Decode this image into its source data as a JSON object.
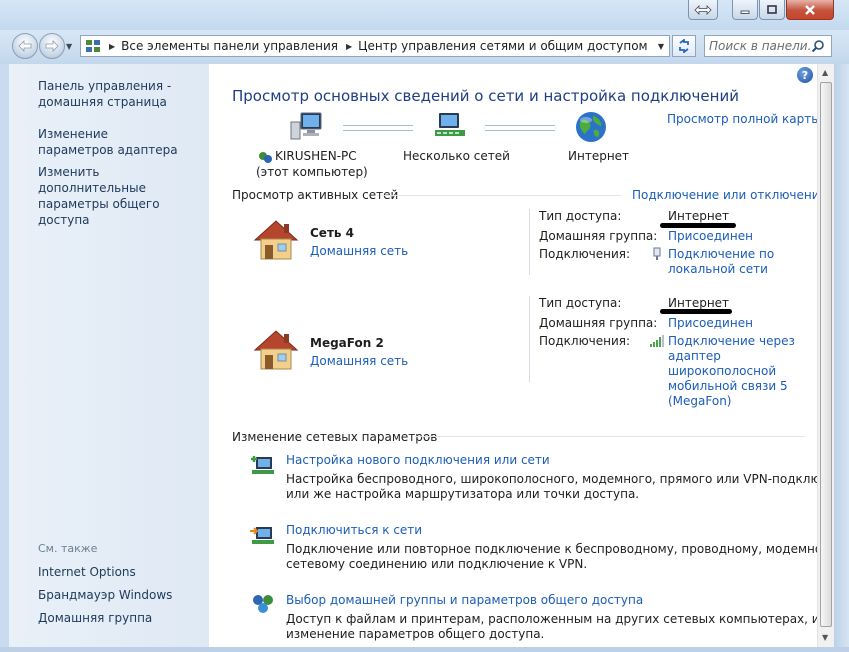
{
  "window": {
    "nav_back_icon": "back-arrow-icon",
    "nav_forward_icon": "forward-arrow-icon"
  },
  "address": {
    "crumbs": [
      "Все элементы панели управления",
      "Центр управления сетями и общим доступом"
    ]
  },
  "search": {
    "placeholder": "Поиск в панели..."
  },
  "sidebar": {
    "home": "Панель управления - домашняя страница",
    "adapter": "Изменение параметров адаптера",
    "sharing": "Изменить дополнительные параметры общего доступа",
    "see_also_title": "См. также",
    "see_also": [
      "Internet Options",
      "Брандмауэр Windows",
      "Домашняя группа"
    ]
  },
  "main": {
    "title": "Просмотр основных сведений о сети и настройка подключений",
    "view_full_map": "Просмотр полной карты",
    "map": {
      "computer_name": "KIRUSHEN-PC",
      "computer_sub": "(этот компьютер)",
      "middle": "Несколько сетей",
      "internet": "Интернет"
    },
    "active_networks_title": "Просмотр активных сетей",
    "connect_disconnect": "Подключение или отключение",
    "networks": [
      {
        "name": "Сеть  4",
        "type": "Домашняя сеть",
        "access_label": "Тип доступа:",
        "access_value": "Интернет",
        "homegroup_label": "Домашняя группа:",
        "homegroup_value": "Присоединен",
        "connections_label": "Подключения:",
        "connection_lines": [
          "Подключение по",
          "локальной сети"
        ]
      },
      {
        "name": "MegaFon  2",
        "type": "Домашняя сеть",
        "access_label": "Тип доступа:",
        "access_value": "Интернет",
        "homegroup_label": "Домашняя группа:",
        "homegroup_value": "Присоединен",
        "connections_label": "Подключения:",
        "connection_lines": [
          "Подключение через",
          "адаптер",
          "широкополосной",
          "мобильной связи 5",
          "(MegaFon)"
        ]
      }
    ],
    "change_settings_title": "Изменение сетевых параметров",
    "tasks": [
      {
        "title": "Настройка нового подключения или сети",
        "desc": [
          "Настройка беспроводного, широкополосного, модемного, прямого или VPN-подключения",
          "или же настройка маршрутизатора или точки доступа."
        ]
      },
      {
        "title": "Подключиться к сети",
        "desc": [
          "Подключение или повторное подключение к беспроводному, проводному, модемному",
          "сетевому соединению или подключение к VPN."
        ]
      },
      {
        "title": "Выбор домашней группы и параметров общего доступа",
        "desc": [
          "Доступ к файлам и принтерам, расположенным на других сетевых компьютерах, или",
          "изменение параметров общего доступа."
        ]
      }
    ]
  },
  "colors": {
    "link": "#1b5db7",
    "title": "#1e3e83",
    "sidebar_link": "#1e395b",
    "chrome": "#c9dcef"
  }
}
